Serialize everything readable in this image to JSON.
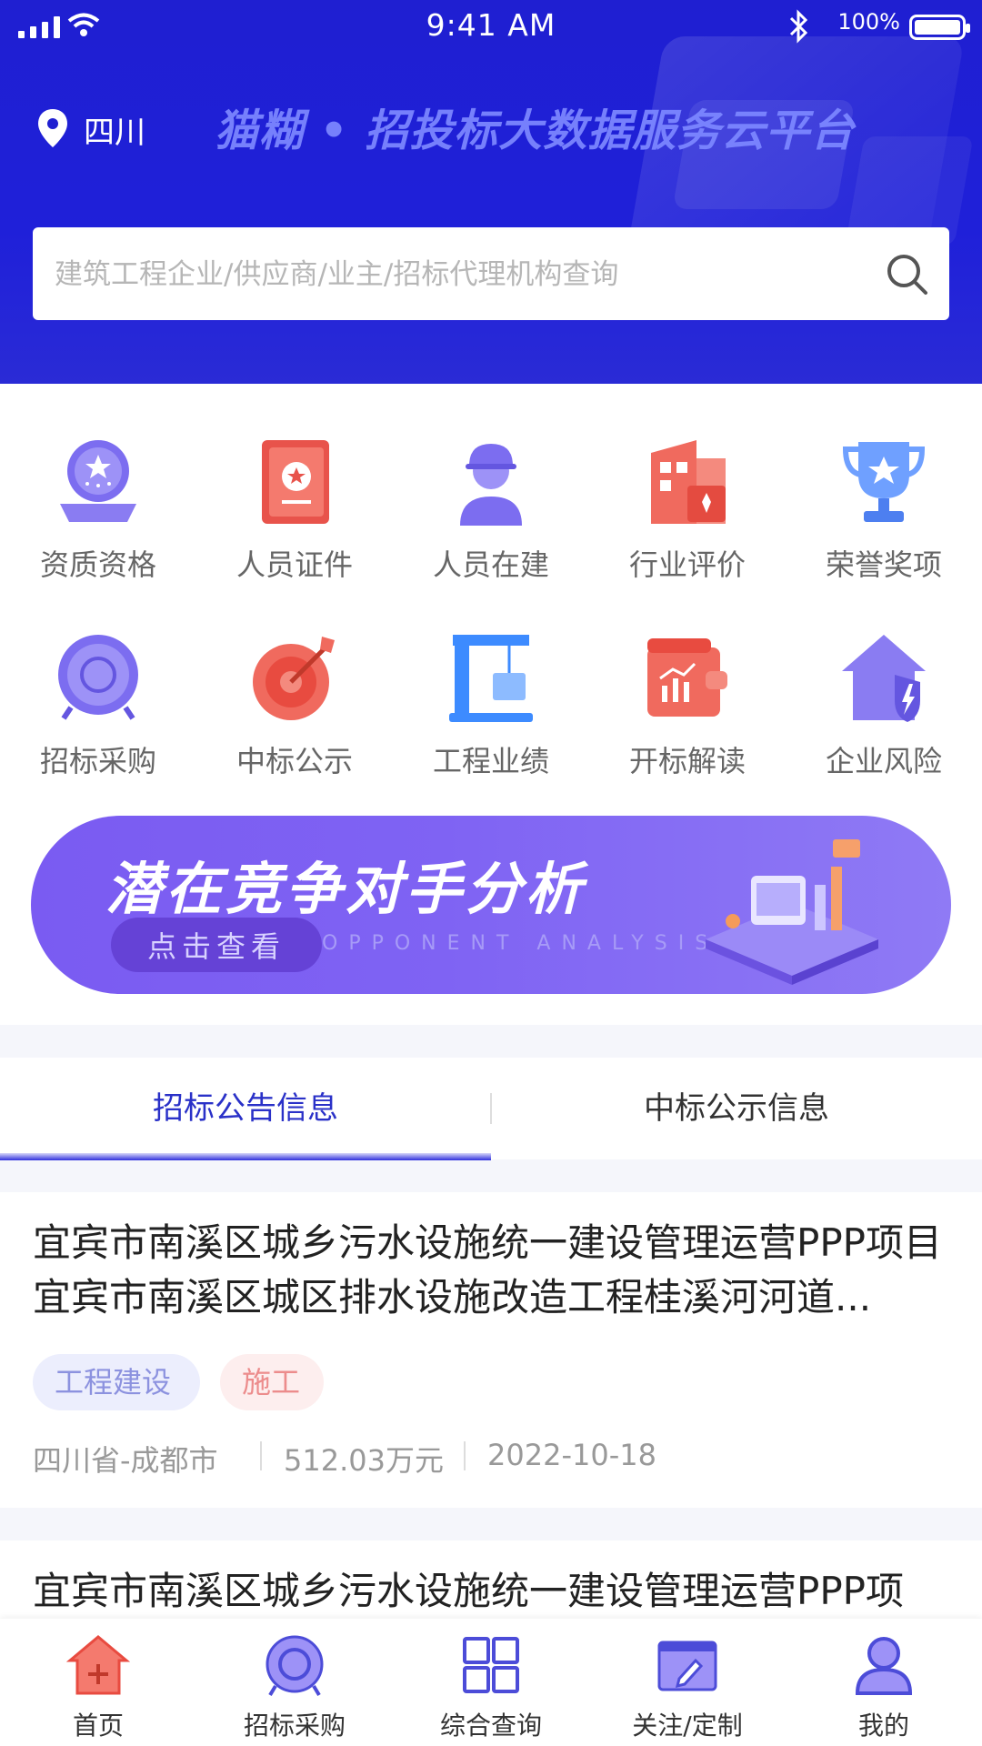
{
  "status_bar": {
    "time": "9:41 AM",
    "battery": "100%",
    "battery_level": 1.0
  },
  "header": {
    "location": "四川",
    "platform_title": "猫糊 • 招投标大数据服务云平台"
  },
  "search": {
    "placeholder": "建筑工程企业/供应商/业主/招标代理机构查询",
    "value": ""
  },
  "grid": [
    {
      "label": "资质资格",
      "icon": "qualification-icon"
    },
    {
      "label": "人员证件",
      "icon": "certificate-icon"
    },
    {
      "label": "人员在建",
      "icon": "worker-icon"
    },
    {
      "label": "行业评价",
      "icon": "building-rating-icon"
    },
    {
      "label": "荣誉奖项",
      "icon": "trophy-icon"
    },
    {
      "label": "招标采购",
      "icon": "bidding-icon"
    },
    {
      "label": "中标公示",
      "icon": "target-icon"
    },
    {
      "label": "工程业绩",
      "icon": "crane-icon"
    },
    {
      "label": "开标解读",
      "icon": "wallet-chart-icon"
    },
    {
      "label": "企业风险",
      "icon": "shield-house-icon"
    }
  ],
  "banner": {
    "title": "潜在竞争对手分析",
    "button": "点击查看",
    "subtitle": "OPPONENT ANALYSIS"
  },
  "tabs": [
    {
      "label": "招标公告信息",
      "active": true
    },
    {
      "label": "中标公示信息",
      "active": false
    }
  ],
  "listings": [
    {
      "title": "宜宾市南溪区城乡污水设施统一建设管理运营PPP项目宜宾市南溪区城区排水设施改造工程桂溪河河道...",
      "tags": [
        "工程建设",
        "施工"
      ],
      "region": "四川省-成都市",
      "amount": "512.03万元",
      "date": "2022-10-18"
    },
    {
      "title": "宜宾市南溪区城乡污水设施统一建设管理运营PPP项"
    }
  ],
  "bottom_nav": [
    {
      "label": "首页",
      "icon": "home-icon",
      "active": true
    },
    {
      "label": "招标采购",
      "icon": "bidding-icon"
    },
    {
      "label": "综合查询",
      "icon": "grid-query-icon"
    },
    {
      "label": "关注/定制",
      "icon": "follow-icon"
    },
    {
      "label": "我的",
      "icon": "user-icon"
    }
  ],
  "colors": {
    "primary": "#1f1fd1",
    "accent": "#2a31c8",
    "banner": "#7a5bf2",
    "tag_blue_bg": "#eceefd",
    "tag_pink_bg": "#fdeeee"
  }
}
